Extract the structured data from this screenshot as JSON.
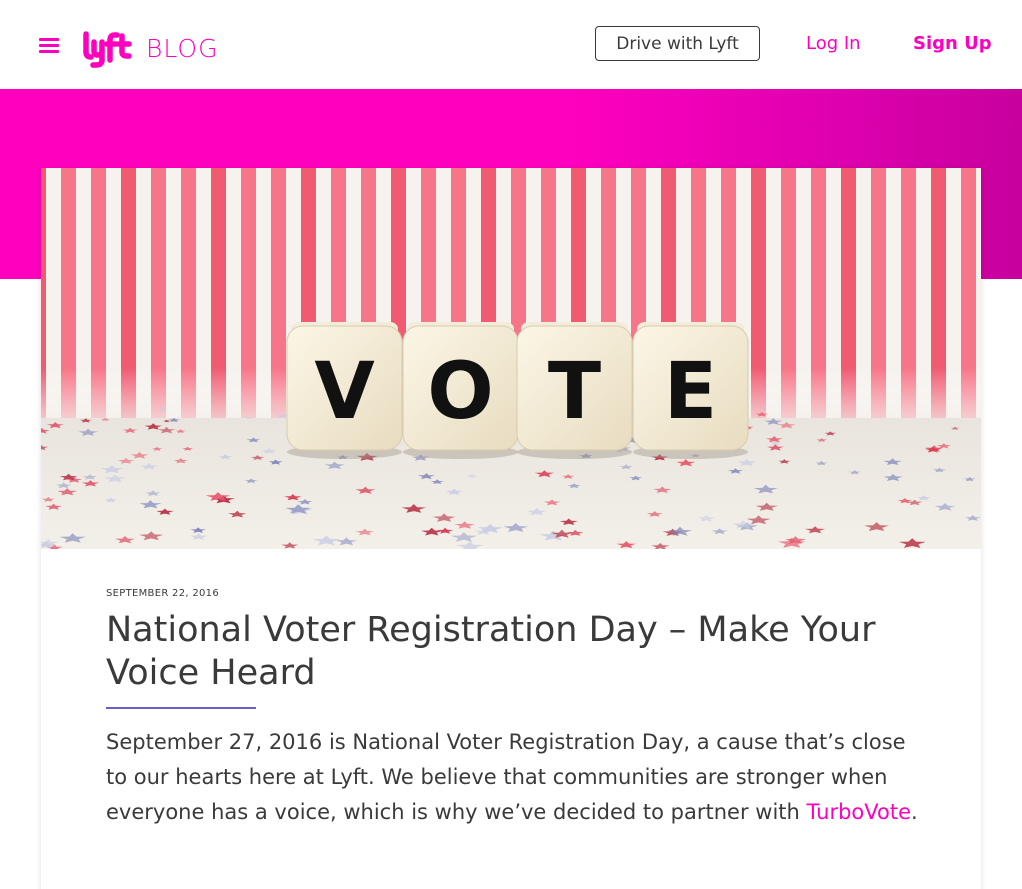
{
  "header": {
    "menu_icon": "hamburger-menu-icon",
    "logo_text": "lyft",
    "blog_label": "BLOG",
    "drive_button": "Drive with Lyft",
    "login_link": "Log In",
    "signup_link": "Sign Up"
  },
  "colors": {
    "brand_pink": "#ff00bf",
    "text_dark": "#3a3a3a",
    "title_rule": "#6b5dd3"
  },
  "hero": {
    "dice_letters": [
      "V",
      "O",
      "T",
      "E"
    ]
  },
  "post": {
    "date": "SEPTEMBER 22, 2016",
    "title": "National Voter Registration Day – Make Your Voice Heard",
    "body_text": "September 27, 2016 is National Voter Registration Day, a cause that’s close to our hearts here at Lyft. We believe that communities are stronger when everyone has a voice, which is why we’ve decided to partner with ",
    "body_link": "TurboVote",
    "body_end": "."
  }
}
